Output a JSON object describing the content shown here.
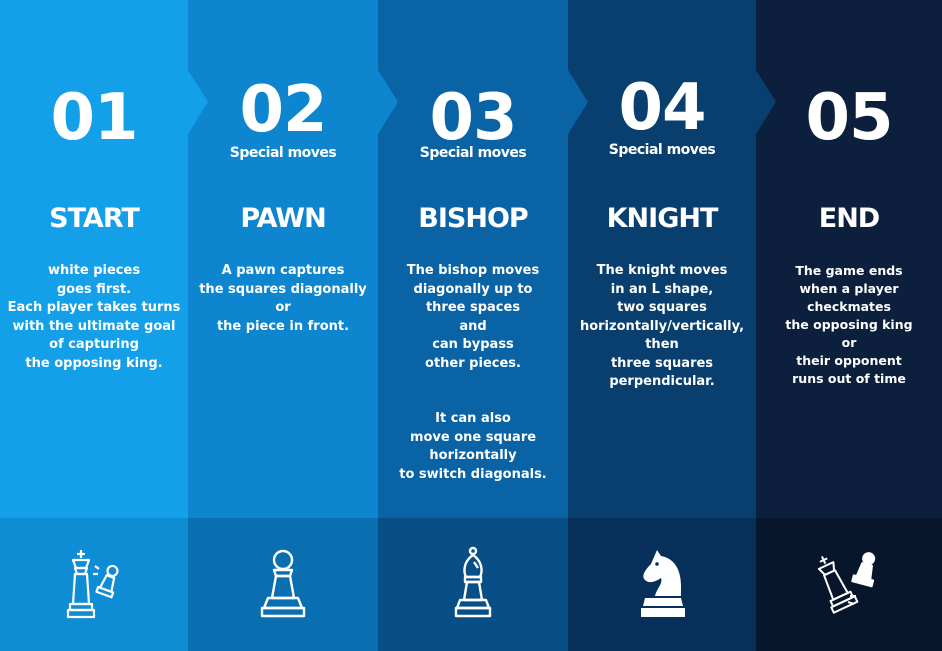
{
  "colors": {
    "col1": "#14a0e8",
    "col1_foot": "#0e8cd4",
    "col2": "#0d86cf",
    "col2_foot": "#0a6fb0",
    "col3": "#0963a4",
    "col3_foot": "#074f86",
    "col4": "#083f6f",
    "col4_foot": "#06305a",
    "col5": "#0c1f3c",
    "col5_foot": "#08162c"
  },
  "steps": [
    {
      "number": "01",
      "subtitle": "",
      "heading": "START",
      "lines": [
        "white pieces",
        "goes first.",
        "Each player takes turns",
        "with the ultimate goal",
        "of capturing",
        "the opposing king."
      ],
      "icon": "king-pawn-icon"
    },
    {
      "number": "02",
      "subtitle": "Special moves",
      "heading": "PAWN",
      "lines": [
        "A pawn captures",
        "the squares diagonally",
        "or",
        "the piece in front."
      ],
      "icon": "pawn-icon"
    },
    {
      "number": "03",
      "subtitle": "Special moves",
      "heading": "BISHOP",
      "lines": [
        "The bishop moves",
        "diagonally up to",
        "three spaces",
        "and",
        "can bypass",
        "other pieces."
      ],
      "lines2": [
        "It can also",
        "move one square",
        "horizontally",
        "to switch diagonals."
      ],
      "icon": "bishop-icon"
    },
    {
      "number": "04",
      "subtitle": "Special moves",
      "heading": "KNIGHT",
      "lines": [
        "The knight moves",
        "in an L shape,",
        "two squares",
        "horizontally/vertically,",
        "then",
        "three squares",
        "perpendicular."
      ],
      "icon": "knight-icon"
    },
    {
      "number": "05",
      "subtitle": "",
      "heading": "END",
      "lines": [
        "The game ends",
        "when a player",
        "checkmates",
        "the opposing king",
        "or",
        "their opponent",
        "runs out of time"
      ],
      "icon": "checkmate-icon"
    }
  ]
}
